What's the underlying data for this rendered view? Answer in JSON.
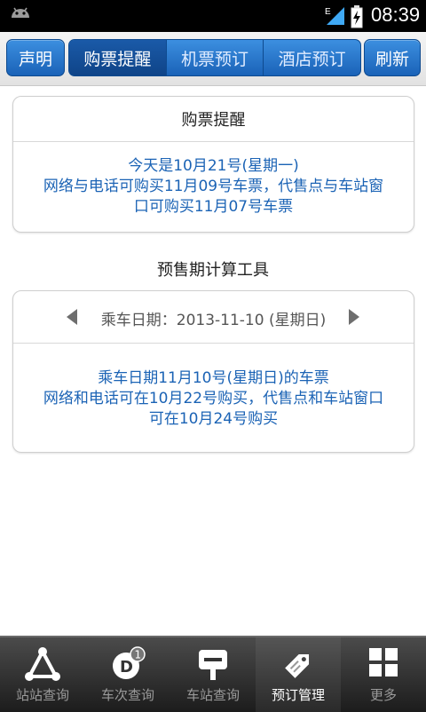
{
  "status_bar": {
    "time": "08:39",
    "network": "E"
  },
  "toolbar": {
    "left_button": "声明",
    "tabs": [
      {
        "label": "购票提醒",
        "active": true
      },
      {
        "label": "机票预订",
        "active": false
      },
      {
        "label": "酒店预订",
        "active": false
      }
    ],
    "right_button": "刷新"
  },
  "reminder_card": {
    "title": "购票提醒",
    "lines": [
      "今天是10月21号(星期一)",
      "网络与电话可购买11月09号车票，代售点与车站窗",
      "口可购买11月07号车票"
    ]
  },
  "calculator": {
    "title": "预售期计算工具",
    "date_label": "乘车日期：2013-11-10 (星期日)",
    "lines": [
      "乘车日期11月10号(星期日)的车票",
      "网络和电话可在10月22号购买，代售点和车站窗口",
      "可在10月24号购买"
    ]
  },
  "bottom_nav": [
    {
      "label": "站站查询",
      "icon": "route-triangle-icon",
      "active": false
    },
    {
      "label": "车次查询",
      "icon": "train-number-icon",
      "badge": "1",
      "active": false
    },
    {
      "label": "车站查询",
      "icon": "station-sign-icon",
      "active": false
    },
    {
      "label": "预订管理",
      "icon": "ticket-tag-icon",
      "active": true
    },
    {
      "label": "更多",
      "icon": "grid-icon",
      "active": false
    }
  ],
  "colors": {
    "accent": "#1b63b5",
    "button": "#2a75cc",
    "nav_bg": "#2b2b2b"
  }
}
